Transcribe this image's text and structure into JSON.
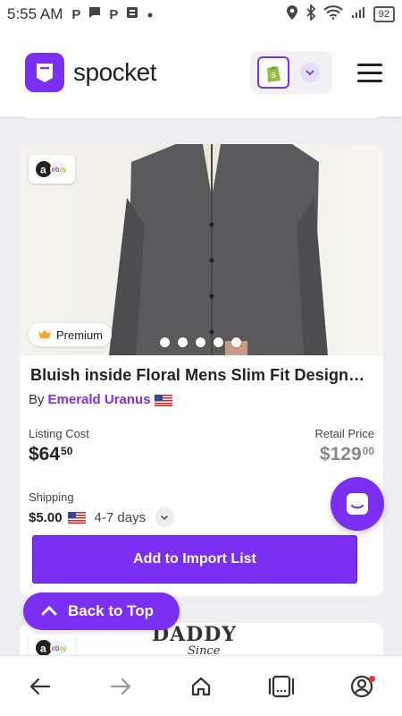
{
  "status_bar": {
    "time": "5:55 AM",
    "left_icons": [
      "parking-icon",
      "chat-bubble-icon",
      "parking-icon",
      "news-icon",
      "dot-icon"
    ],
    "right_icons": [
      "location-icon",
      "bluetooth-icon",
      "wifi-icon",
      "signal-icon",
      "battery-icon"
    ],
    "battery": "92"
  },
  "header": {
    "brand": "spocket",
    "store_icon": "shopify-icon",
    "menu_icon": "hamburger-menu-icon"
  },
  "colors": {
    "accent": "#7b2ff2",
    "price_muted": "#888888"
  },
  "product": {
    "platform_badge": "amazon-ebay-icon",
    "premium_label": "Premium",
    "premium_icon": "crown-icon",
    "carousel_dots": 5,
    "title": "Bluish inside Floral Mens Slim Fit Designer Fr...",
    "by_label": "By",
    "supplier": "Emerald Uranus",
    "origin_flag": "us-flag-icon",
    "listing_cost_label": "Listing Cost",
    "listing_cost_whole": "$64",
    "listing_cost_cents": "50",
    "retail_price_label": "Retail Price",
    "retail_price_whole": "$129",
    "retail_price_cents": "00",
    "shipping_label": "Shipping",
    "shipping_cost": "$5.00",
    "shipping_days": "4-7 days",
    "import_button": "Add to Import List"
  },
  "next_product": {
    "platform_badge": "amazon-ebay-icon",
    "image_text_1": "DADDY",
    "image_text_2": "Since"
  },
  "back_to_top": "Back to Top",
  "browser_nav": [
    "back-arrow-icon",
    "forward-arrow-icon",
    "home-icon",
    "tabs-icon",
    "account-icon"
  ]
}
